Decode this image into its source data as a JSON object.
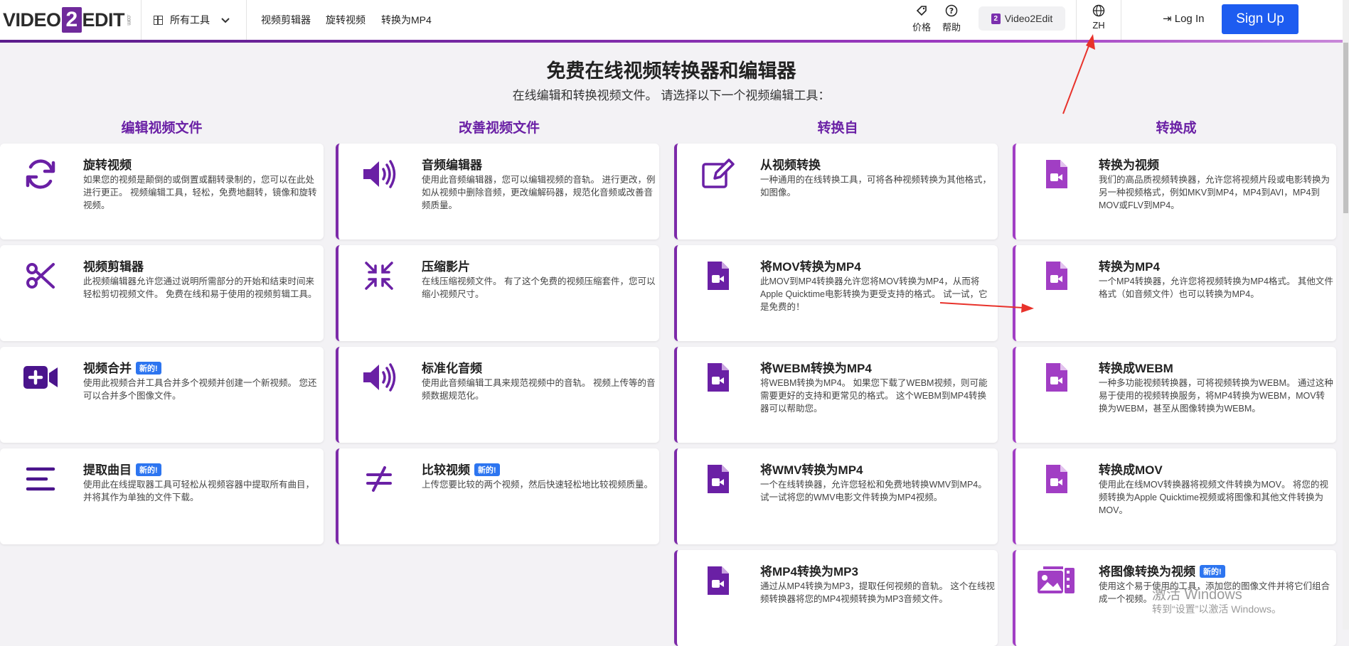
{
  "header": {
    "logo": {
      "pre": "VIDEO",
      "two": "2",
      "post": "EDIT",
      "com": ".com"
    },
    "all_tools": "所有工具",
    "nav": [
      "视频剪辑器",
      "旋转视频",
      "转换为MP4"
    ],
    "price": "价格",
    "help": "帮助",
    "v2e_btn": "Video2Edit",
    "v2e_mini": "2",
    "lang": "ZH",
    "login": "Log In",
    "signup": "Sign Up"
  },
  "hero": {
    "title": "免费在线视频转换器和编辑器",
    "subtitle": "在线编辑和转换视频文件。 请选择以下一个视频编辑工具："
  },
  "columns": [
    "编辑视频文件",
    "改善视频文件",
    "转换自",
    "转换成"
  ],
  "new_badge": "新的!",
  "cards": {
    "c1": [
      {
        "title": "旋转视频",
        "desc": "如果您的视频是颠倒的或倒置或翻转录制的，您可以在此处进行更正。 视频编辑工具，轻松，免费地翻转，镜像和旋转视频。",
        "icon": "rotate-icon"
      },
      {
        "title": "视频剪辑器",
        "desc": "此视频编辑器允许您通过说明所需部分的开始和结束时间来轻松剪切视频文件。 免费在线和易于使用的视频剪辑工具。",
        "icon": "scissors-icon"
      },
      {
        "title": "视频合并",
        "desc": "使用此视频合并工具合并多个视频并创建一个新视频。 您还可以合并多个图像文件。",
        "icon": "video-plus-icon"
      },
      {
        "title": "提取曲目",
        "desc": "使用此在线提取器工具可轻松从视频容器中提取所有曲目，并将其作为单独的文件下载。",
        "icon": "lines-icon"
      }
    ],
    "c2": [
      {
        "title": "音频编辑器",
        "desc": "使用此音频编辑器，您可以编辑视频的音轨。 进行更改，例如从视频中删除音频，更改编解码器，规范化音频或改善音频质量。",
        "icon": "speaker-icon"
      },
      {
        "title": "压缩影片",
        "desc": "在线压缩视频文件。 有了这个免费的视频压缩套件，您可以缩小视频尺寸。",
        "icon": "compress-icon"
      },
      {
        "title": "标准化音频",
        "desc": "使用此音频编辑工具来规范视频中的音轨。 视频上传等的音频数据规范化。",
        "icon": "speaker-icon"
      },
      {
        "title": "比较视频",
        "desc": "上传您要比较的两个视频，然后快速轻松地比较视频质量。",
        "icon": "not-equal-icon"
      }
    ],
    "c3": [
      {
        "title": "从视频转换",
        "desc": "一种通用的在线转换工具，可将各种视频转换为其他格式，如图像。",
        "icon": "edit-icon"
      },
      {
        "title": "将MOV转换为MP4",
        "desc": "此MOV到MP4转换器允许您将MOV转换为MP4，从而将Apple Quicktime电影转换为更受支持的格式。 试一试，它是免费的！",
        "icon": "video-file-icon"
      },
      {
        "title": "将WEBM转换为MP4",
        "desc": "将WEBM转换为MP4。 如果您下载了WEBM视频，则可能需要更好的支持和更常见的格式。 这个WEBM到MP4转换器可以帮助您。",
        "icon": "video-file-icon"
      },
      {
        "title": "将WMV转换为MP4",
        "desc": "一个在线转换器，允许您轻松和免费地转换WMV到MP4。 试一试将您的WMV电影文件转换为MP4视频。",
        "icon": "video-file-icon"
      },
      {
        "title": "将MP4转换为MP3",
        "desc": "通过从MP4转换为MP3，提取任何视频的音轨。 这个在线视频转换器将您的MP4视频转换为MP3音频文件。",
        "icon": "video-file-icon"
      }
    ],
    "c4": [
      {
        "title": "转换为视频",
        "desc": "我们的高品质视频转换器，允许您将视频片段或电影转换为另一种视频格式，例如MKV到MP4，MP4到AVI，MP4到MOV或FLV到MP4。",
        "icon": "video-file-icon"
      },
      {
        "title": "转换为MP4",
        "desc": "一个MP4转换器，允许您将视频转换为MP4格式。 其他文件格式（如音频文件）也可以转换为MP4。",
        "icon": "video-file-icon"
      },
      {
        "title": "转换成WEBM",
        "desc": "一种多功能视频转换器，可将视频转换为WEBM。 通过这种易于使用的视频转换服务，将MP4转换为WEBM，MOV转换为WEBM，甚至从图像转换为WEBM。",
        "icon": "video-file-icon"
      },
      {
        "title": "转换成MOV",
        "desc": "使用此在线MOV转换器将视频文件转换为MOV。 将您的视频转换为Apple Quicktime视频或将图像和其他文件转换为MOV。",
        "icon": "video-file-icon"
      },
      {
        "title": "将图像转换为视频",
        "desc": "使用这个易于使用的工具，添加您的图像文件并将它们组合成一个视频。",
        "icon": "images-video-icon"
      }
    ]
  },
  "watermark": {
    "line1": "激活 Windows",
    "line2": "转到“设置”以激活 Windows。"
  },
  "colors": {
    "accent": "#6a20a5",
    "pink": "#a13ec4",
    "signup": "#1d5cf0",
    "badge": "#2d75f0",
    "annotation": "#e8322b"
  }
}
